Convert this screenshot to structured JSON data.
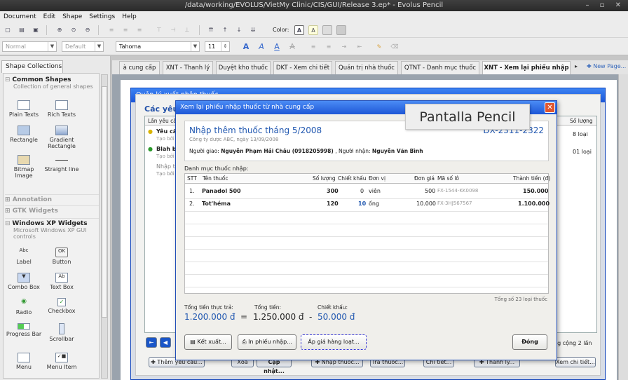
{
  "window": {
    "title": "/data/working/EVOLUS/VietMy Clinic/CIS/GUI/Release 3.ep* - Evolus Pencil",
    "controls": "– ▫ ✕"
  },
  "menu": [
    "Document",
    "Edit",
    "Shape",
    "Settings",
    "Help"
  ],
  "toolbar": {
    "color_label": "Color:",
    "font_style": "Normal",
    "font_variant": "Default",
    "font_family": "Tahoma",
    "font_size": "11"
  },
  "left": {
    "tab": "Shape Collections",
    "common": {
      "title": "Common Shapes",
      "sub": "Collection of general shapes"
    },
    "shapes_common": [
      "Plain Texts",
      "Rich Texts",
      "Rectangle",
      "Gradient Rectangle",
      "Bitmap Image",
      "Straight line"
    ],
    "annotation": "Annotation",
    "gtk": "GTK Widgets",
    "xp": {
      "title": "Windows XP Widgets",
      "sub": "Microsoft Windows XP GUI controls"
    },
    "shapes_xp": [
      "Label",
      "Button",
      "Combo Box",
      "Text Box",
      "Radio",
      "Checkbox",
      "Progress Bar",
      "Scrollbar",
      "Menu",
      "Menu Item"
    ]
  },
  "tabs": [
    "à cung cấp",
    "XNT - Thanh lý",
    "Duyệt kho thuốc",
    "DKT - Xem chi tiết",
    "Quản trị nhà thuốc",
    "QTNT - Danh mục thuốc",
    "XNT - Xem lại phiếu nhập",
    "New Page..."
  ],
  "bgwin": {
    "title": "Quản lý xuất nhập thuốc",
    "heading": "Các yêu",
    "col1": "Lần yêu cầu",
    "col2": "Số lượng",
    "rows": [
      {
        "t": "Yêu cầ",
        "s": "Tạo bởi",
        "q": "8 loại"
      },
      {
        "t": "Blah bl",
        "s": "Tạo bởi",
        "q": "01 loại"
      },
      {
        "t": "Nhập t",
        "s": "Tạo bởi",
        "q": ""
      }
    ],
    "count": "ng cộng 2 lần",
    "buttons": [
      "Thêm yêu cầu...",
      "Xóa",
      "Cập nhật...",
      "Nhập thuốc...",
      "Trả thuốc...",
      "Chi tiết...",
      "Thanh lý...",
      "Xem chi tiết..."
    ]
  },
  "dialog": {
    "title": "Xem lại phiếu nhập thuốc từ nhà cung cấp",
    "heading": "Nhập thêm thuốc tháng 5/2008",
    "code": "DX-2311-2322",
    "company": "Công ty dược ABC, ngày 13/09/2008",
    "sender_label": "Người giao:",
    "sender": "Nguyễn Phạm Hải Châu (0918205998)",
    "receiver_label": ", Người nhận:",
    "receiver": "Nguyễn Văn Bình",
    "list_label": "Danh mục thuốc nhập:",
    "cols": [
      "STT",
      "Tên thuốc",
      "Số lượng",
      "Chiết khấu",
      "Đơn vị",
      "Đơn giá",
      "Mã số lô",
      "Thành tiền (đ)"
    ],
    "rows": [
      [
        "1.",
        "Panadol 500",
        "300",
        "0",
        "viên",
        "500",
        "FX-1544-KK0098",
        "150.000"
      ],
      [
        "2.",
        "Tot'héma",
        "120",
        "10",
        "ống",
        "10.000",
        "FX-3HJ567567",
        "1.100.000"
      ]
    ],
    "total_types": "Tổng số 23 loại thuốc",
    "paid_label": "Tổng tiền thực trả:",
    "paid": "1.200.000 đ",
    "eq": "=",
    "sum_label": "Tổng tiền:",
    "sum": "1.250.000 đ",
    "minus": "-",
    "disc_label": "Chiết khấu:",
    "disc": "50.000 đ",
    "btn_export": "Kết xuất...",
    "btn_print": "In phiếu nhập...",
    "btn_apply": "Áp giá hàng loạt...",
    "btn_close": "Đóng"
  },
  "tooltip": "Pantalla Pencil"
}
